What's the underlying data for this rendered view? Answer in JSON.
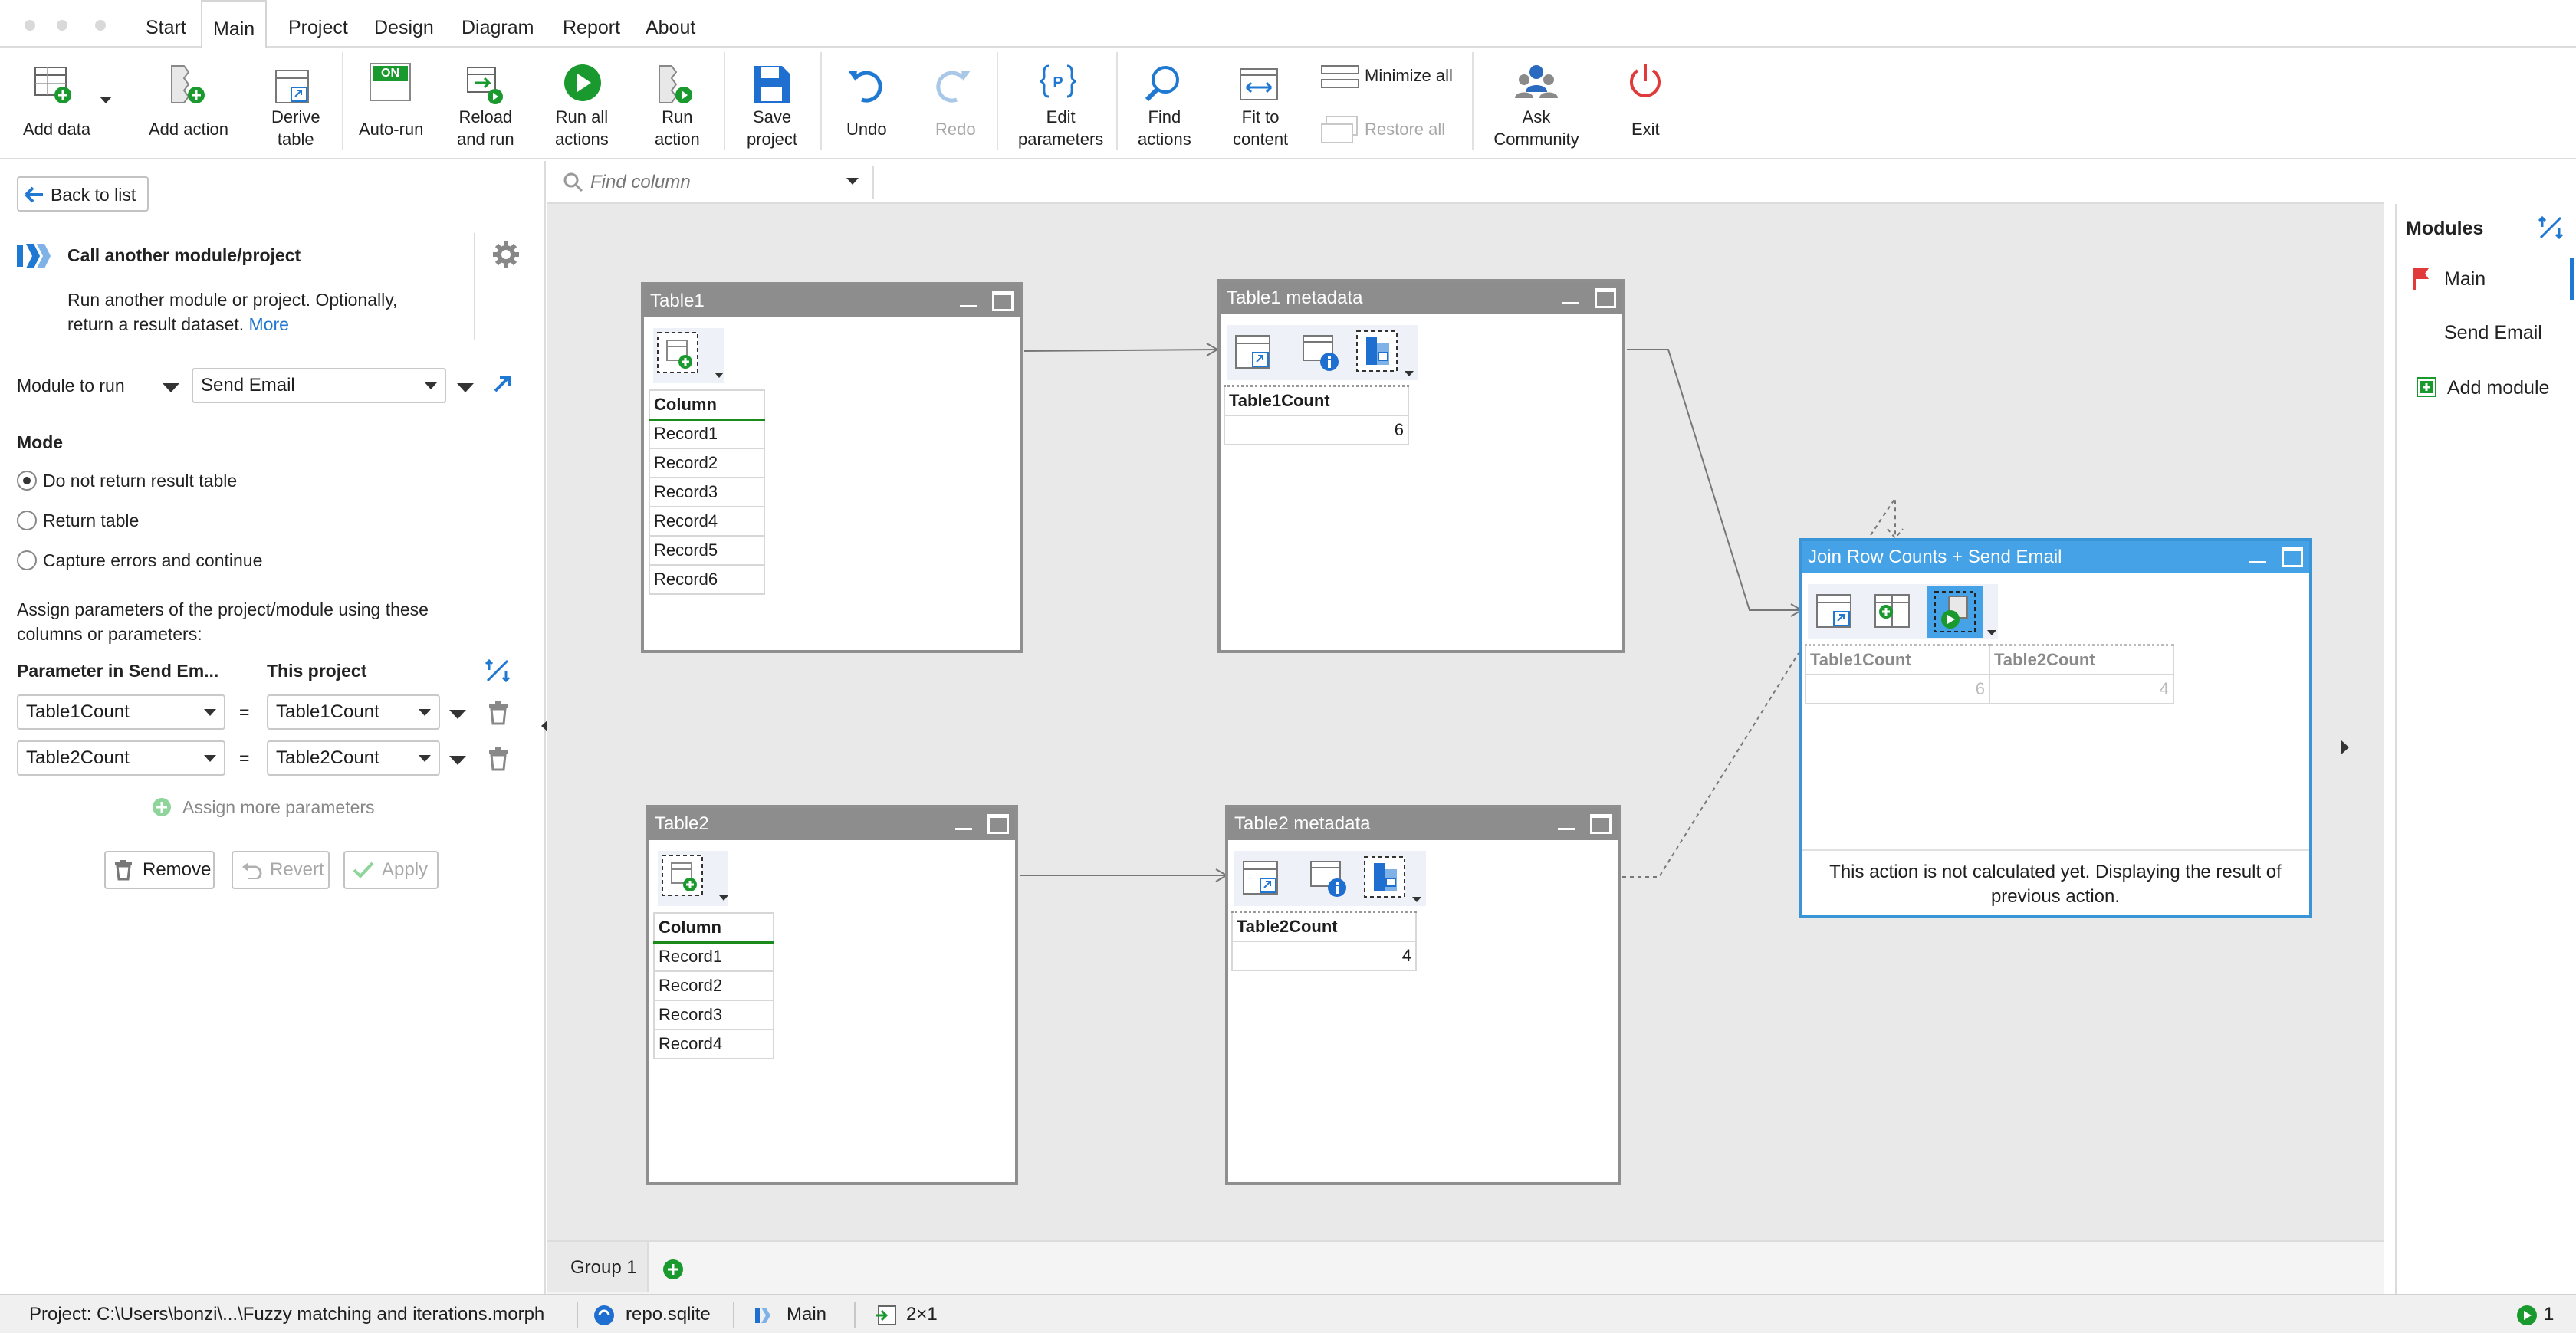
{
  "menu": {
    "items": [
      "Start",
      "Main",
      "Project",
      "Design",
      "Diagram",
      "Report",
      "About"
    ],
    "active": "Main"
  },
  "ribbon": {
    "add_data": "Add data",
    "add_action": "Add action",
    "derive_table_1": "Derive",
    "derive_table_2": "table",
    "auto_run": "Auto-run",
    "auto_run_badge": "ON",
    "reload_1": "Reload",
    "reload_2": "and run",
    "run_all_1": "Run all",
    "run_all_2": "actions",
    "run_action_1": "Run",
    "run_action_2": "action",
    "save_1": "Save",
    "save_2": "project",
    "undo": "Undo",
    "redo": "Redo",
    "edit_params_1": "Edit",
    "edit_params_2": "parameters",
    "find_actions_1": "Find",
    "find_actions_2": "actions",
    "fit_1": "Fit to",
    "fit_2": "content",
    "minimize_all": "Minimize all",
    "restore_all": "Restore all",
    "ask_1": "Ask",
    "ask_2": "Community",
    "exit": "Exit"
  },
  "left": {
    "back": "Back to list",
    "title": "Call another module/project",
    "desc_1": "Run another module or project. Optionally,",
    "desc_2": "return a result dataset.",
    "more": "More",
    "module_label": "Module to run",
    "module_value": "Send Email",
    "mode_heading": "Mode",
    "modes": [
      "Do not return result table",
      "Return table",
      "Capture errors and continue"
    ],
    "assign_1": "Assign parameters of the project/module using these",
    "assign_2": "columns or parameters:",
    "col_param": "Parameter in Send Em...",
    "col_project": "This project",
    "rows": [
      {
        "param": "Table1Count",
        "eq": "=",
        "value": "Table1Count"
      },
      {
        "param": "Table2Count",
        "eq": "=",
        "value": "Table2Count"
      }
    ],
    "assign_more": "Assign more parameters",
    "remove": "Remove",
    "revert": "Revert",
    "apply": "Apply"
  },
  "find": {
    "placeholder": "Find column"
  },
  "nodes": {
    "table1": {
      "title": "Table1",
      "header": "Column",
      "rows": [
        "Record1",
        "Record2",
        "Record3",
        "Record4",
        "Record5",
        "Record6"
      ]
    },
    "table1meta": {
      "title": "Table1 metadata",
      "header": "Table1Count",
      "value": "6"
    },
    "table2": {
      "title": "Table2",
      "header": "Column",
      "rows": [
        "Record1",
        "Record2",
        "Record3",
        "Record4"
      ]
    },
    "table2meta": {
      "title": "Table2 metadata",
      "header": "Table2Count",
      "value": "4"
    },
    "join": {
      "title": "Join Row Counts + Send Email",
      "h1": "Table1Count",
      "h2": "Table2Count",
      "v1": "6",
      "v2": "4",
      "note_1": "This action is not calculated yet. Displaying the result of",
      "note_2": "previous action."
    }
  },
  "modules": {
    "heading": "Modules",
    "items": [
      "Main",
      "Send Email"
    ],
    "add": "Add module"
  },
  "tabs": {
    "group": "Group 1"
  },
  "status": {
    "project": "Project: C:\\Users\\bonzi\\...\\Fuzzy matching and iterations.morph",
    "repo": "repo.sqlite",
    "module": "Main",
    "size": "2×1",
    "count": "1"
  },
  "colors": {
    "accent": "#1f78d1",
    "green": "#1a9a2e",
    "selected": "#45a2e6"
  }
}
